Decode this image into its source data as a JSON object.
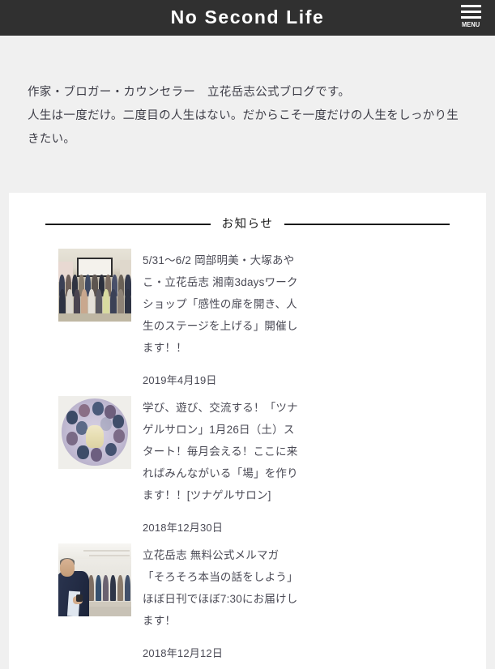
{
  "header": {
    "site_title": "No Second Life",
    "menu_label": "MENU",
    "menu_icon": "hamburger-menu-icon",
    "background_color": "#303030",
    "title_color": "#ffffff"
  },
  "intro": {
    "lines": [
      "作家・ブロガー・カウンセラー　立花岳志公式ブログです。",
      "人生は一度だけ。二度目の人生はない。だからこそ一度だけの人生をしっかり生きたい。"
    ],
    "text_color": "#3c3c46",
    "background_color": "#f0f0f0"
  },
  "news_section": {
    "heading": "お知らせ",
    "rule_color": "#1a1a1a",
    "items": [
      {
        "title": "5/31〜6/2 岡部明美・大塚あやこ・立花岳志 湘南3daysワークショップ「感性の扉を開き、人生のステージを上げる」開催します！！",
        "date": "2019年4月19日",
        "thumbnail": "group-photo-seminar-room-thumbnail"
      },
      {
        "title": "学び、遊び、交流する！「ツナゲルサロン」1月26日（土）スタート！毎月会える！ここに来ればみんながいる「場」を作ります！！[ツナゲルサロン]",
        "date": "2018年12月30日",
        "thumbnail": "circular-group-photo-thumbnail"
      },
      {
        "title": "立花岳志 無料公式メルマガ「そろそろ本当の話をしよう」ほぼ日刊でほぼ7:30にお届けします！",
        "date": "2018年12月12日",
        "thumbnail": "man-in-suit-seminar-thumbnail"
      }
    ]
  }
}
